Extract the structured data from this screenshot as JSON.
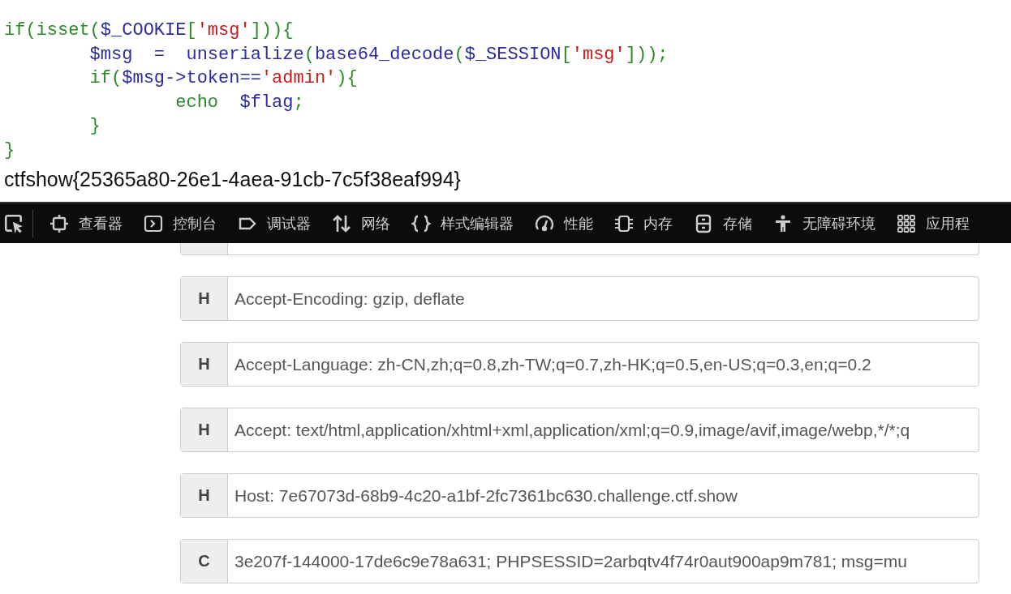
{
  "code_lines": [
    {
      "tokens": [
        {
          "kind": "kw",
          "text": "if(isset("
        },
        {
          "kind": "var",
          "text": "$_COOKIE"
        },
        {
          "kind": "kw",
          "text": "["
        },
        {
          "kind": "str",
          "text": "'msg'"
        },
        {
          "kind": "kw",
          "text": "])){"
        }
      ]
    },
    {
      "tokens": [
        {
          "kind": "var",
          "text": "        $msg  =  unserialize"
        },
        {
          "kind": "kw",
          "text": "("
        },
        {
          "kind": "var",
          "text": "base64_decode"
        },
        {
          "kind": "kw",
          "text": "("
        },
        {
          "kind": "var",
          "text": "$_SESSION"
        },
        {
          "kind": "kw",
          "text": "["
        },
        {
          "kind": "str",
          "text": "'msg'"
        },
        {
          "kind": "kw",
          "text": "]));"
        }
      ]
    },
    {
      "tokens": [
        {
          "kind": "kw",
          "text": "        if("
        },
        {
          "kind": "var",
          "text": "$msg->token=="
        },
        {
          "kind": "str",
          "text": "'admin'"
        },
        {
          "kind": "kw",
          "text": "){"
        }
      ]
    },
    {
      "tokens": [
        {
          "kind": "kw",
          "text": "                echo  "
        },
        {
          "kind": "var",
          "text": "$flag"
        },
        {
          "kind": "kw",
          "text": ";"
        }
      ]
    },
    {
      "tokens": [
        {
          "kind": "kw",
          "text": "        }"
        }
      ]
    },
    {
      "tokens": [
        {
          "kind": "kw",
          "text": "}"
        }
      ]
    }
  ],
  "flag": "ctfshow{25365a80-26e1-4aea-91cb-7c5f38eaf994}",
  "devtools_tabs": [
    {
      "kind": "inspector",
      "label": "查看器"
    },
    {
      "kind": "console",
      "label": "控制台"
    },
    {
      "kind": "debugger",
      "label": "调试器"
    },
    {
      "kind": "network",
      "label": "网络"
    },
    {
      "kind": "style",
      "label": "样式编辑器"
    },
    {
      "kind": "performance",
      "label": "性能"
    },
    {
      "kind": "memory",
      "label": "内存"
    },
    {
      "kind": "storage",
      "label": "存储"
    },
    {
      "kind": "accessibility",
      "label": "无障碍环境"
    },
    {
      "kind": "apps",
      "label": "应用程"
    }
  ],
  "header_rows": [
    {
      "prefix": "H",
      "value": "Accept-Encoding: gzip, deflate"
    },
    {
      "prefix": "H",
      "value": "Accept-Language: zh-CN,zh;q=0.8,zh-TW;q=0.7,zh-HK;q=0.5,en-US;q=0.3,en;q=0.2"
    },
    {
      "prefix": "H",
      "value": "Accept: text/html,application/xhtml+xml,application/xml;q=0.9,image/avif,image/webp,*/*;q"
    },
    {
      "prefix": "H",
      "value": "Host: 7e67073d-68b9-4c20-a1bf-2fc7361bc630.challenge.ctf.show"
    },
    {
      "prefix": "C",
      "value": "3e207f-144000-17de6c9e78a631; PHPSESSID=2arbqtv4f74r0aut900ap9m781; msg=mu"
    }
  ]
}
